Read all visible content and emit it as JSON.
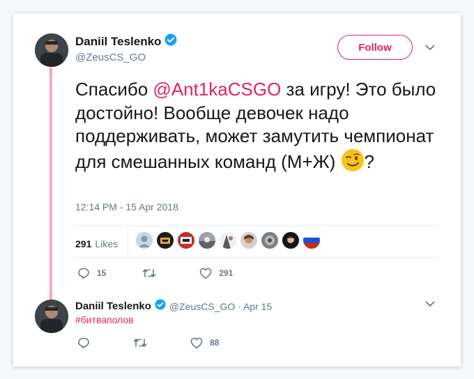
{
  "main_tweet": {
    "author_name": "Daniil Teslenko",
    "author_handle": "@ZeusCS_GO",
    "follow_label": "Follow",
    "text_before": "Спасибо ",
    "mention": "@Ant1kaCSGO",
    "text_after": " за игру! Это было достойно! Вообще девочек надо поддерживать, может замутить чемпионат для смешанных команд (М+Ж) ",
    "text_end": "?",
    "timestamp": "12:14 PM - 15 Apr 2018",
    "likes_count": "291",
    "likes_label": "Likes",
    "reply_count": "15",
    "retweet_count": "",
    "like_count": "291"
  },
  "reply_tweet": {
    "author_name": "Daniil Teslenko",
    "handle_date": "@ZeusCS_GO · Apr 15",
    "text": "#битваполов",
    "reply_count": "",
    "retweet_count": "",
    "like_count": "88"
  },
  "colors": {
    "accent": "#e0245e",
    "thread_line": "#f4a7c4",
    "verified": "#1da1f2",
    "muted": "#657786"
  },
  "icons": [
    "verified-badge-icon",
    "chevron-down-icon",
    "reply-icon",
    "retweet-icon",
    "heart-icon",
    "winking-face-emoji"
  ]
}
